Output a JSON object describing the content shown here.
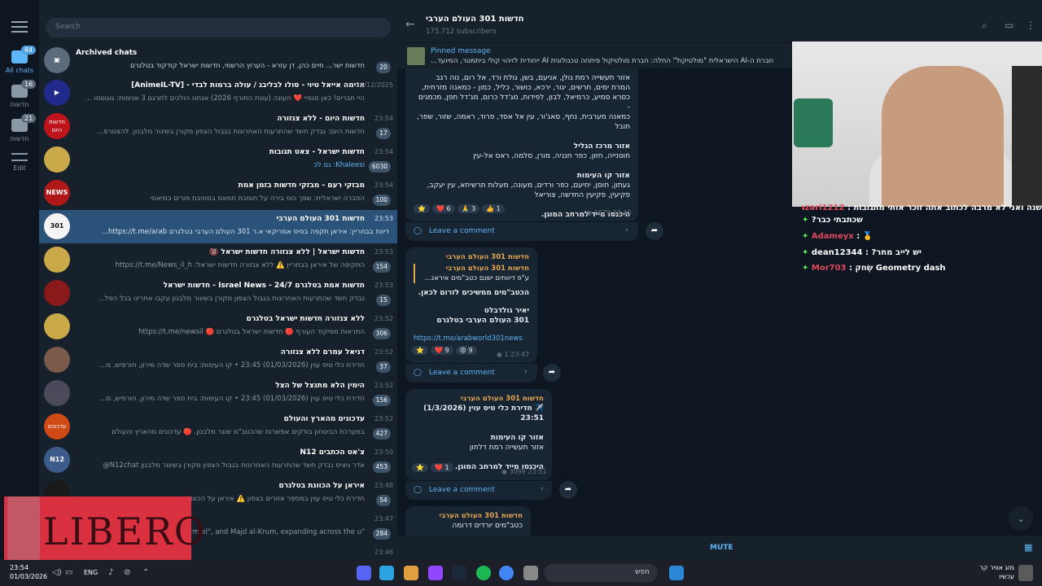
{
  "search": {
    "placeholder": "Search"
  },
  "folders": [
    {
      "label": "All chats",
      "badge": "84",
      "icon": "chat-bubbles-icon"
    },
    {
      "label": "חדשות",
      "badge": "16",
      "icon": "chat-bubbles-icon"
    },
    {
      "label": "חדשות",
      "badge": "21",
      "icon": "chat-bubbles-icon"
    },
    {
      "label": "Edit",
      "badge": "",
      "icon": "sliders-icon"
    }
  ],
  "archived": {
    "title": "Archived chats",
    "preview": "חדשות ישר... חיים כהן, דן עזרא - הערוץ הרשמי, חדשות ישראל קודקוד בטלגרם",
    "count": "20"
  },
  "chats": [
    {
      "title": "אנימה אייאל טיוי - סולו לבליבג / עולה ברמות לבדי - [AnimeIL-TV]",
      "time": "24/12/2025",
      "preview": "היי חברים! כאן סנפיי ❤️ העונה (עונת החורף 2026) אנחנו הולכים לתרגם 3 אנימות: גוגוטסו ...",
      "count": "",
      "avatar": "▶"
    },
    {
      "title": "חדשות היום - ללא צנזורה",
      "time": "23:54",
      "preview": "חדשות היום: נבדק חשד שהתרעות האחרונות בגבול הצפון מקורן בשיגור מלבנון. להצטרפ...",
      "count": "17",
      "avatar": "חדשות היום"
    },
    {
      "title": "חדשות ישראל - צאט תגובות",
      "time": "23:54",
      "preview": "Khaleesi: גם לכ",
      "count": "6030",
      "avatar": ""
    },
    {
      "title": "מבזקי רעם - מבזקי חדשות בזמן אמת",
      "time": "23:54",
      "preview": "הסברה ישראלית: שפך כוס בירה על תומכת חמאס במסיבת פורים במיאמי",
      "count": "100",
      "avatar": "NEWS"
    },
    {
      "title": "חדשות 301 העולם הערבי",
      "time": "23:53",
      "preview": "דיווח בבחריין: איראן תקפה בסיס אמריקאי א.ר 301 העולם הערבי בטלגרם https://t.me/arab...",
      "count": "",
      "avatar": "301"
    },
    {
      "title": "חדשות ישראל | ללא צנזורה חדשות ישראל 🔞",
      "time": "23:53",
      "preview": "התקיפה של איראן בבחריין ⚠️ ללא צנזורה חדשות ישראל: https://t.me/News_il_h",
      "count": "154",
      "avatar": ""
    },
    {
      "title": "חדשות אמת בטלגרם 24/7 - Israel News - חדשות ישראל",
      "time": "23:53",
      "preview": "נבדק חשד שהתרעות האחרונות בגבול הצפון מקורן בשיגור מלבנון עקבו אחרינו בכל הפל...",
      "count": "15",
      "avatar": ""
    },
    {
      "title": "ללא צנזורה חדשות ישראל בטלגרם",
      "time": "23:52",
      "preview": "התראות מפיקוד העורף 🔴 חדשות ישראל בטלגרם 🔴 https://t.me/newsil",
      "count": "306",
      "avatar": ""
    },
    {
      "title": "דניאל עמרם ללא צנזורה",
      "time": "23:52",
      "preview": "חדירת כלי טיס עוין (01/03/2026) 23:45 • קו העימות: בית ספר שדה מירון, חורפיש, מ...",
      "count": "37",
      "avatar": ""
    },
    {
      "title": "הימין הלא מתנצל של הצל",
      "time": "23:52",
      "preview": "חדירת כלי טיס עוין (01/03/2026) 23:45 • קו העימות: בית ספר שדה מירון, חורפיש, מ...",
      "count": "156",
      "avatar": ""
    },
    {
      "title": "עדכונים מהארץ והעולם",
      "time": "23:52",
      "preview": "במערכת הביטחון בודקים אפשרות שהכטב\"מ שוגר מלבנון. 🔴 עדכונים מהארץ והעולם",
      "count": "427",
      "avatar": "עדכונים"
    },
    {
      "title": "צ'אט הכתבים N12",
      "time": "23:50",
      "preview": "אדר גיציס נבדק חשד שהתרעות האחרונות בגבול הצפון מקורן בשיגור מלבנון N12chat@",
      "count": "453",
      "avatar": "N12"
    },
    {
      "title": "איראן על הכוונת בטלגרם",
      "time": "23:48",
      "preview": "חדירת כלי טיס עוין במספר אזורים בצפון ⚠️ איראן על הכוונת",
      "count": "54",
      "avatar": ""
    },
    {
      "title": "",
      "time": "23:47",
      "preview": "\"Karmiel\", and Majd al-Krum, expanding across the u...",
      "count": "284",
      "avatar": ""
    },
    {
      "title": "",
      "time": "23:46",
      "preview": "",
      "count": "",
      "avatar": ""
    }
  ],
  "channel": {
    "title": "חדשות 301 העולם הערבי",
    "subscribers": "175,712 subscribers"
  },
  "pinned": {
    "label": "Pinned message",
    "text": "חברת ה-AI הישראלית \"מולטיקול\" החלה: חברת מולטיקול פיתחה טכנולוגית AI ייחודית לזיהוי קולי ביתמטר, המיועד..."
  },
  "message1": {
    "lines_top": [
      "אזור תעשייה רמת גולן, אניעם, בשן, גולת ורד, אל רום, נוה רגב",
      "המרת ימים, חרשים, יגור, ירכא, כושור, כליל, כמון - כמאנה מזרחית,",
      "כסרא סמיע, כרמיאל, לבון, לפידות, מג'דל כרום, מג'דל תפן, מכמנים -",
      "כמאנה מערבית, נחף, סאג'ור, עין אל אסד, פרוד, ראמה, שזור, שפר,",
      "תובל"
    ],
    "section2_title": "אזור מרכז הגליל",
    "section2_text": "חוסנייה, חזון, כפר חנניה, מורן, סלמה, ראס אל-עין",
    "section3_title": "אזור קו העימות",
    "section3_lines": [
      "געתון, חוסן, יחיעם, כפר ורדים, מעונה, מעלות תרשיחא, עין יעקב,",
      "פקיעין, פקיעין החדשה, צוריאל"
    ],
    "instruction": "היכנסו מייד למרחב המוגן.",
    "reactions": [
      "⭐",
      "❤️ 6",
      "🙏 3",
      "👍 1"
    ],
    "views": "1079",
    "time": "23:46",
    "comment": "Leave a comment"
  },
  "message2": {
    "sender": "חדשות 301 העולם הערבי",
    "quote_sender": "חדשות 301 העולם הערבי",
    "quote_text": "ע\"פ דיווחים ישנם כטב\"מים איראנ...",
    "text": "הכטב\"מים ממשיכים לזרום לכאן.",
    "signature1": "יאיר גולדבלט",
    "signature2": "301 העולם הערבי בטלגרם",
    "link": "https://t.me/arabworld301news",
    "reactions": [
      "⭐",
      "❤️ 9",
      "😡 9"
    ],
    "views": "1",
    "time": "23:47",
    "comment": "Leave a comment"
  },
  "message3": {
    "sender": "חדשות 301 העולם הערבי",
    "headline": "✈️ חדירת כלי טיס עוין (1/3/2026) 23:51",
    "section_title": "אזור קו העימות",
    "section_text": "אזור תעשייה רמת דלתון",
    "instruction": "היכנסו מייד למרחב המוגן.",
    "reactions": [
      "⭐",
      "❤️ 1"
    ],
    "views": "3099",
    "time": "23:51",
    "comment": "Leave a comment"
  },
  "message4": {
    "sender": "חדשות 301 העולם הערבי",
    "text": "כטב\"מים יורדים דרומה"
  },
  "bottom": {
    "mute": "MUTE"
  },
  "stream_chat": [
    {
      "user": "nazari1212",
      "text": "שנה ואני לא מרבה לכתוב אתה זוכר אותי מתגובות :",
      "user_color": "red"
    },
    {
      "user": "",
      "text": "?שכתבתי כבר",
      "user_color": "green"
    },
    {
      "user": "Adameyx",
      "text": ": 🥇",
      "user_color": "red"
    },
    {
      "user": "dean12344",
      "text": ": ?יש לייב מחר",
      "user_color": "green"
    },
    {
      "user": "Mor703",
      "text": ": שְׂחק Geometry dash",
      "user_color": "red"
    }
  ],
  "overlay": {
    "brand": "LIBERO"
  },
  "taskbar": {
    "time": "23:54",
    "date": "01/03/2026",
    "lang": "ENG",
    "search": "חפש",
    "weather_line1": "מזג אוויר קר",
    "weather_line2": "עכשיו"
  },
  "colors": {
    "accent": "#5eb5f7",
    "active_chat": "#2b5278",
    "sidebar": "#17212b",
    "bg": "#0e1621"
  }
}
